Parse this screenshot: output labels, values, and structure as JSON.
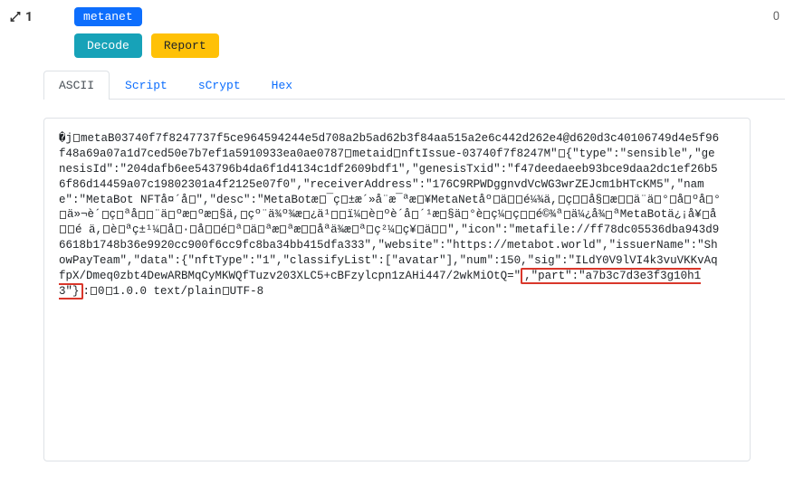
{
  "header": {
    "input_index": "1",
    "tag": "metanet",
    "count": "0"
  },
  "buttons": {
    "decode": "Decode",
    "report": "Report"
  },
  "tabs": {
    "ascii": "ASCII",
    "script": "Script",
    "scrypt": "sCrypt",
    "hex": "Hex"
  },
  "ascii_content": {
    "part1": "�j□metaB03740f7f8247737f5ce964594244e5d708a2b5ad62b3f84aa515a2e6c442d262e4@d620d3c40106749d4e5f96f48a69a07a1d7ced50e7b7ef1a5910933ea0ae0787□metaid□nftIssue-03740f7f8247M\"□{\"type\":\"sensible\",\"genesisId\":\"204dafb6ee543796b4da6f1d4134c1df2609bdf1\",\"genesisTxid\":\"f47deedaeeb93bce9daa2dc1ef26b56f86d14459a07c19802301a4f2125e07f0\",\"receiverAddress\":\"176C9RPWDggnvdVcWG3wrZEJcm1bHTcKM5\",\"name\":\"MetaBot NFTå¤´å□\",\"desc\":\"MetaBotæ□¯ç□±æ´»å¨æ¯ªæ□¥MetaNetåº□ä□□é¼¾ä,□ç□□å§□æ□□ä¨ä□°□å□ºå□°□ä»¬è´□ç□ªå□□¨ä□ºæ□ºæ□§ä,□çº¨ä¾º¾æ□¿ä¹□□ï¼□è□ºè´å□´¹æ□§ä□°è□ç¼□ç□□é©¾ª□ä¼¿å¾□ªMetaBotä¿¡å¥□å□□é ä,□è□ªç±¹¼□å□·□å□□é□ª□ä□ªæ□ªæ□□åªä¾æ□ª□ç²¼□ç¥□ä□□\",\"icon\":\"metafile://ff78dc05536dba943d96618b1748b36e9920cc900f6cc9fc8ba34bb415dfa333\",\"website\":\"https://metabot.world\",\"issuerName\":\"ShowPayTeam\",\"data\":{\"nftType\":\"1\",\"classifyList\":[\"avatar\"],\"num\":150,\"sig\":\"ILdY0V9lVI4k3vuVKKvAqfpX/Dmeq0zbt4DewARBMqCyMKWQfTuzv203XLC5+cBFzylcpn1zAHi447/2wkMiOtQ=\"",
    "highlight": ",\"part\":\"a7b3c7d3e3f3g10h13\"}",
    "part2": ":□0□1.0.0 text/plain□UTF-8"
  }
}
